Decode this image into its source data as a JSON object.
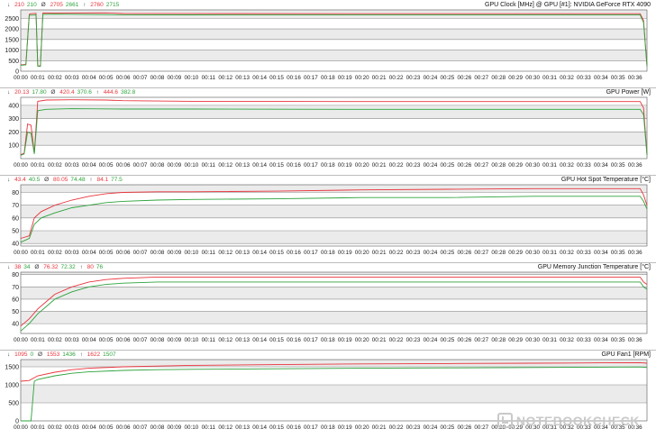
{
  "chart_data": [
    {
      "type": "line",
      "title": "GPU Clock [MHz] @ GPU [#1]: NVIDIA GeForce RTX 4090",
      "stats": {
        "min_label": "↓",
        "min_r": "210",
        "min_g": "210",
        "avg_label": "Ø",
        "avg_r": "2705",
        "avg_g": "2661",
        "max_label": "↑",
        "max_r": "2760",
        "max_g": "2715"
      },
      "ylim": [
        0,
        2900
      ],
      "yticks": [
        500,
        1000,
        1500,
        2000,
        2500
      ],
      "ytick_labels": [
        "500",
        "1000",
        "1500",
        "2000",
        "2500"
      ],
      "ytick_label_extra": [
        "0"
      ],
      "series": [
        {
          "color": "#e8343c",
          "values": [
            [
              0,
              300
            ],
            [
              0.3,
              320
            ],
            [
              0.5,
              2700
            ],
            [
              0.6,
              2720
            ],
            [
              0.9,
              2740
            ],
            [
              1.0,
              260
            ],
            [
              1.15,
              240
            ],
            [
              1.3,
              2750
            ],
            [
              2,
              2755
            ],
            [
              5,
              2760
            ],
            [
              6,
              2730
            ],
            [
              10,
              2725
            ],
            [
              20,
              2720
            ],
            [
              30,
              2720
            ],
            [
              36.3,
              2720
            ],
            [
              36.5,
              2400
            ],
            [
              36.7,
              250
            ]
          ]
        },
        {
          "color": "#2da33c",
          "values": [
            [
              0,
              280
            ],
            [
              0.3,
              300
            ],
            [
              0.5,
              2650
            ],
            [
              0.9,
              2660
            ],
            [
              1.0,
              240
            ],
            [
              1.15,
              230
            ],
            [
              1.3,
              2690
            ],
            [
              2,
              2700
            ],
            [
              6,
              2670
            ],
            [
              10,
              2665
            ],
            [
              20,
              2660
            ],
            [
              30,
              2660
            ],
            [
              36.3,
              2660
            ],
            [
              36.5,
              2300
            ],
            [
              36.7,
              230
            ]
          ]
        }
      ],
      "grid_bands": true
    },
    {
      "type": "line",
      "title": "GPU Power [W]",
      "stats": {
        "min_label": "↓",
        "min_r": "20.13",
        "min_g": "17.80",
        "avg_label": "Ø",
        "avg_r": "420.4",
        "avg_g": "370.6",
        "max_label": "↑",
        "max_r": "444.6",
        "max_g": "382.8"
      },
      "ylim": [
        0,
        460
      ],
      "yticks": [
        100,
        200,
        300,
        400
      ],
      "ytick_labels": [
        "100",
        "200",
        "300",
        "400"
      ],
      "series": [
        {
          "color": "#e8343c",
          "values": [
            [
              0,
              30
            ],
            [
              0.2,
              40
            ],
            [
              0.4,
              260
            ],
            [
              0.6,
              250
            ],
            [
              0.8,
              40
            ],
            [
              1.0,
              430
            ],
            [
              1.5,
              440
            ],
            [
              3,
              442
            ],
            [
              5,
              440
            ],
            [
              6,
              435
            ],
            [
              10,
              430
            ],
            [
              20,
              428
            ],
            [
              30,
              428
            ],
            [
              36.3,
              428
            ],
            [
              36.5,
              380
            ],
            [
              36.7,
              30
            ]
          ]
        },
        {
          "color": "#2da33c",
          "values": [
            [
              0,
              25
            ],
            [
              0.2,
              35
            ],
            [
              0.4,
              200
            ],
            [
              0.6,
              190
            ],
            [
              0.8,
              35
            ],
            [
              1.0,
              360
            ],
            [
              1.5,
              370
            ],
            [
              3,
              375
            ],
            [
              6,
              372
            ],
            [
              10,
              372
            ],
            [
              20,
              370
            ],
            [
              30,
              370
            ],
            [
              36.3,
              370
            ],
            [
              36.5,
              330
            ],
            [
              36.7,
              25
            ]
          ]
        }
      ],
      "grid_bands": true
    },
    {
      "type": "line",
      "title": "GPU Hot Spot Temperature [°C]",
      "stats": {
        "min_label": "↓",
        "min_r": "43.4",
        "min_g": "40.5",
        "avg_label": "Ø",
        "avg_r": "80.05",
        "avg_g": "74.48",
        "max_label": "↑",
        "max_r": "84.1",
        "max_g": "77.5"
      },
      "ylim": [
        38,
        86
      ],
      "yticks": [
        40,
        50,
        60,
        70,
        80
      ],
      "ytick_labels": [
        "40",
        "50",
        "60",
        "70",
        "80"
      ],
      "series": [
        {
          "color": "#e8343c",
          "values": [
            [
              0,
              44
            ],
            [
              0.5,
              46
            ],
            [
              0.8,
              60
            ],
            [
              1.2,
              65
            ],
            [
              2,
              70
            ],
            [
              3,
              74
            ],
            [
              4,
              77
            ],
            [
              5,
              79
            ],
            [
              6,
              80
            ],
            [
              8,
              80.5
            ],
            [
              10,
              80.5
            ],
            [
              15,
              81
            ],
            [
              20,
              82
            ],
            [
              25,
              82.5
            ],
            [
              30,
              83
            ],
            [
              34,
              83
            ],
            [
              36.3,
              83
            ],
            [
              36.5,
              78
            ],
            [
              36.7,
              70
            ]
          ]
        },
        {
          "color": "#2da33c",
          "values": [
            [
              0,
              41
            ],
            [
              0.5,
              44
            ],
            [
              0.8,
              55
            ],
            [
              1.2,
              60
            ],
            [
              2,
              64
            ],
            [
              3,
              68
            ],
            [
              4,
              70
            ],
            [
              5,
              72
            ],
            [
              6,
              73
            ],
            [
              8,
              74
            ],
            [
              10,
              74.5
            ],
            [
              15,
              75
            ],
            [
              20,
              76
            ],
            [
              25,
              76
            ],
            [
              30,
              77
            ],
            [
              34,
              77
            ],
            [
              36.3,
              77
            ],
            [
              36.5,
              73
            ],
            [
              36.7,
              67
            ]
          ]
        }
      ],
      "grid_bands": true
    },
    {
      "type": "line",
      "title": "GPU Memory Junction Temperature [°C]",
      "stats": {
        "min_label": "↓",
        "min_r": "38",
        "min_g": "34",
        "avg_label": "Ø",
        "avg_r": "76.32",
        "avg_g": "72.32",
        "max_label": "↑",
        "max_r": "80",
        "max_g": "76"
      },
      "ylim": [
        32,
        82
      ],
      "yticks": [
        40,
        50,
        60,
        70,
        80
      ],
      "ytick_labels": [
        "40",
        "50",
        "60",
        "70",
        "80"
      ],
      "series": [
        {
          "color": "#e8343c",
          "values": [
            [
              0,
              38
            ],
            [
              0.5,
              44
            ],
            [
              1,
              52
            ],
            [
              1.5,
              58
            ],
            [
              2,
              64
            ],
            [
              3,
              70
            ],
            [
              4,
              74
            ],
            [
              5,
              76
            ],
            [
              6,
              77
            ],
            [
              8,
              78
            ],
            [
              10,
              78
            ],
            [
              15,
              78
            ],
            [
              20,
              78
            ],
            [
              25,
              78
            ],
            [
              30,
              78
            ],
            [
              36.3,
              78
            ],
            [
              36.5,
              74
            ],
            [
              36.7,
              72
            ]
          ]
        },
        {
          "color": "#2da33c",
          "values": [
            [
              0,
              34
            ],
            [
              0.5,
              40
            ],
            [
              1,
              48
            ],
            [
              1.5,
              54
            ],
            [
              2,
              60
            ],
            [
              3,
              66
            ],
            [
              4,
              70
            ],
            [
              5,
              72
            ],
            [
              6,
              73
            ],
            [
              8,
              74
            ],
            [
              10,
              74
            ],
            [
              15,
              74
            ],
            [
              20,
              74
            ],
            [
              25,
              74
            ],
            [
              30,
              74
            ],
            [
              36.3,
              74
            ],
            [
              36.5,
              70
            ],
            [
              36.7,
              68
            ]
          ]
        }
      ],
      "grid_bands": true
    },
    {
      "type": "line",
      "title": "GPU Fan1 [RPM]",
      "stats": {
        "min_label": "↓",
        "min_r": "1095",
        "min_g": "0",
        "avg_label": "Ø",
        "avg_r": "1553",
        "avg_g": "1436",
        "max_label": "↑",
        "max_r": "1622",
        "max_g": "1507"
      },
      "ylim": [
        0,
        1700
      ],
      "yticks": [
        500,
        1000,
        1500
      ],
      "ytick_labels": [
        "500",
        "1000",
        "1500"
      ],
      "ytick_label_extra": [
        "0"
      ],
      "series": [
        {
          "color": "#e8343c",
          "values": [
            [
              0,
              1100
            ],
            [
              0.5,
              1120
            ],
            [
              1,
              1250
            ],
            [
              2,
              1350
            ],
            [
              3,
              1420
            ],
            [
              4,
              1460
            ],
            [
              6,
              1500
            ],
            [
              8,
              1520
            ],
            [
              10,
              1540
            ],
            [
              15,
              1560
            ],
            [
              20,
              1580
            ],
            [
              25,
              1590
            ],
            [
              30,
              1600
            ],
            [
              34,
              1610
            ],
            [
              36.3,
              1615
            ],
            [
              36.7,
              1600
            ]
          ]
        },
        {
          "color": "#2da33c",
          "values": [
            [
              0,
              0
            ],
            [
              0.6,
              0
            ],
            [
              0.8,
              1100
            ],
            [
              1,
              1150
            ],
            [
              2,
              1250
            ],
            [
              3,
              1320
            ],
            [
              4,
              1360
            ],
            [
              6,
              1400
            ],
            [
              8,
              1420
            ],
            [
              10,
              1430
            ],
            [
              15,
              1445
            ],
            [
              20,
              1460
            ],
            [
              25,
              1470
            ],
            [
              30,
              1480
            ],
            [
              34,
              1490
            ],
            [
              36.3,
              1495
            ],
            [
              36.7,
              1480
            ]
          ]
        }
      ],
      "grid_bands": true
    }
  ],
  "x_axis": {
    "xlim": [
      0,
      36.7
    ],
    "tick_values": [
      0,
      1,
      2,
      3,
      4,
      5,
      6,
      7,
      8,
      9,
      10,
      11,
      12,
      13,
      14,
      15,
      16,
      17,
      18,
      19,
      20,
      21,
      22,
      23,
      24,
      25,
      26,
      27,
      28,
      29,
      30,
      31,
      32,
      33,
      34,
      35,
      36
    ],
    "tick_labels": [
      "00:00",
      "00:01",
      "00:02",
      "00:03",
      "00:04",
      "00:05",
      "00:06",
      "00:07",
      "00:08",
      "00:09",
      "00:10",
      "00:11",
      "00:12",
      "00:13",
      "00:14",
      "00:15",
      "00:16",
      "00:17",
      "00:18",
      "00:19",
      "00:20",
      "00:21",
      "00:22",
      "00:23",
      "00:24",
      "00:25",
      "00:26",
      "00:27",
      "00:28",
      "00:29",
      "00:30",
      "00:31",
      "00:32",
      "00:33",
      "00:34",
      "00:35",
      "00:36"
    ]
  },
  "colors": {
    "grid_band": "#ebebeb",
    "grid_line": "#8c8c8c",
    "axis": "#555555"
  },
  "watermark": {
    "text": "NOTEBOOKCHECK",
    "icon": "checkmark-logo-icon"
  }
}
